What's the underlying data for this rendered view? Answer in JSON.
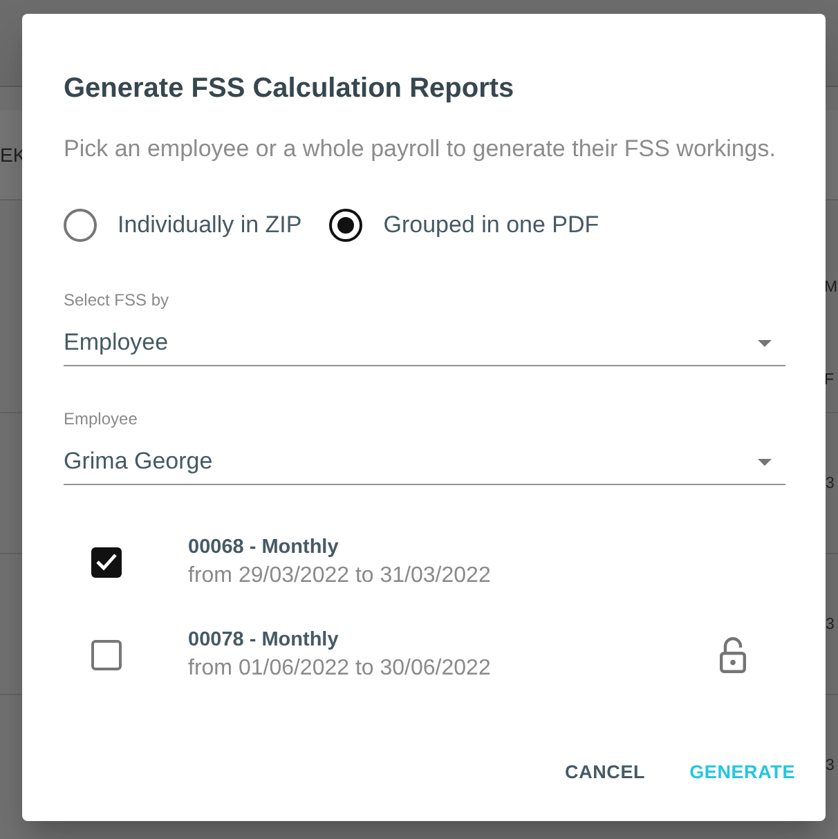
{
  "background": {
    "tab_label": "EK",
    "header_texts": [
      "M",
      "F"
    ],
    "row_cells": [
      "3",
      "3",
      "3"
    ]
  },
  "dialog": {
    "title": "Generate FSS Calculation Reports",
    "description": "Pick an employee or a whole payroll to generate their FSS workings.",
    "export_options": [
      {
        "label": "Individually in ZIP",
        "selected": false
      },
      {
        "label": "Grouped in one PDF",
        "selected": true
      }
    ],
    "fields": [
      {
        "label": "Select FSS by",
        "value": "Employee"
      },
      {
        "label": "Employee",
        "value": "Grima George"
      }
    ],
    "payrolls": [
      {
        "title": "00068 - Monthly",
        "period": "from 29/03/2022 to 31/03/2022",
        "checked": true,
        "lock_icon": false
      },
      {
        "title": "00078 - Monthly",
        "period": "from 01/06/2022 to 30/06/2022",
        "checked": false,
        "lock_icon": true
      }
    ],
    "buttons": [
      {
        "label": "CANCEL",
        "kind": "cancel"
      },
      {
        "label": "GENERATE",
        "kind": "confirm"
      }
    ]
  }
}
